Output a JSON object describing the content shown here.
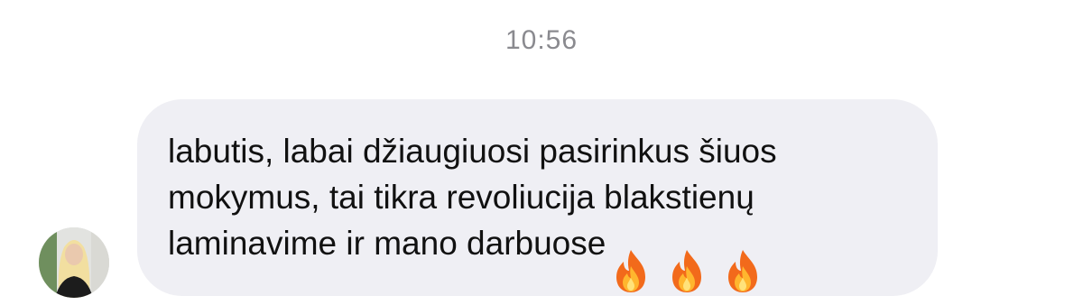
{
  "header": {
    "timestamp": "10:56"
  },
  "message": {
    "sender": "incoming",
    "text": "labutis, labai džiaugiuosi pasirinkus šiuos\nmokymus, tai tikra revoliucija blakstienų\nlaminavime ir mano darbuose",
    "emojis": [
      "fire-icon",
      "fire-icon",
      "fire-icon"
    ],
    "bubble_color": "#efeff4"
  },
  "colors": {
    "timestamp": "#8a8a8f",
    "text": "#111111",
    "background": "#ffffff"
  }
}
